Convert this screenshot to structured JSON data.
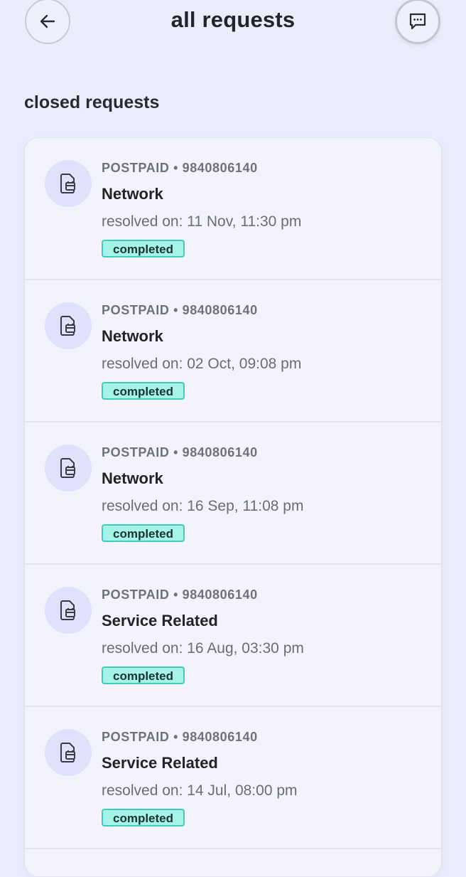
{
  "header": {
    "title": "all requests",
    "back_icon": "arrow-left-icon",
    "chat_icon": "chat-bubble-icon"
  },
  "section": {
    "title": "closed requests"
  },
  "requests": [
    {
      "meta": "POSTPAID • 9840806140",
      "type": "Network",
      "resolved": "resolved on: 11 Nov, 11:30 pm",
      "status": "completed"
    },
    {
      "meta": "POSTPAID • 9840806140",
      "type": "Network",
      "resolved": "resolved on: 02 Oct, 09:08 pm",
      "status": "completed"
    },
    {
      "meta": "POSTPAID • 9840806140",
      "type": "Network",
      "resolved": "resolved on: 16 Sep, 11:08 pm",
      "status": "completed"
    },
    {
      "meta": "POSTPAID • 9840806140",
      "type": "Service Related",
      "resolved": "resolved on: 16 Aug, 03:30 pm",
      "status": "completed"
    },
    {
      "meta": "POSTPAID • 9840806140",
      "type": "Service Related",
      "resolved": "resolved on: 14 Jul, 08:00 pm",
      "status": "completed"
    }
  ],
  "colors": {
    "background": "#ecedfc",
    "card": "#f3f4fb",
    "icon_circle": "#dfe2fa",
    "status_fill": "#a6f3e8",
    "status_border": "#3fcbb9"
  }
}
